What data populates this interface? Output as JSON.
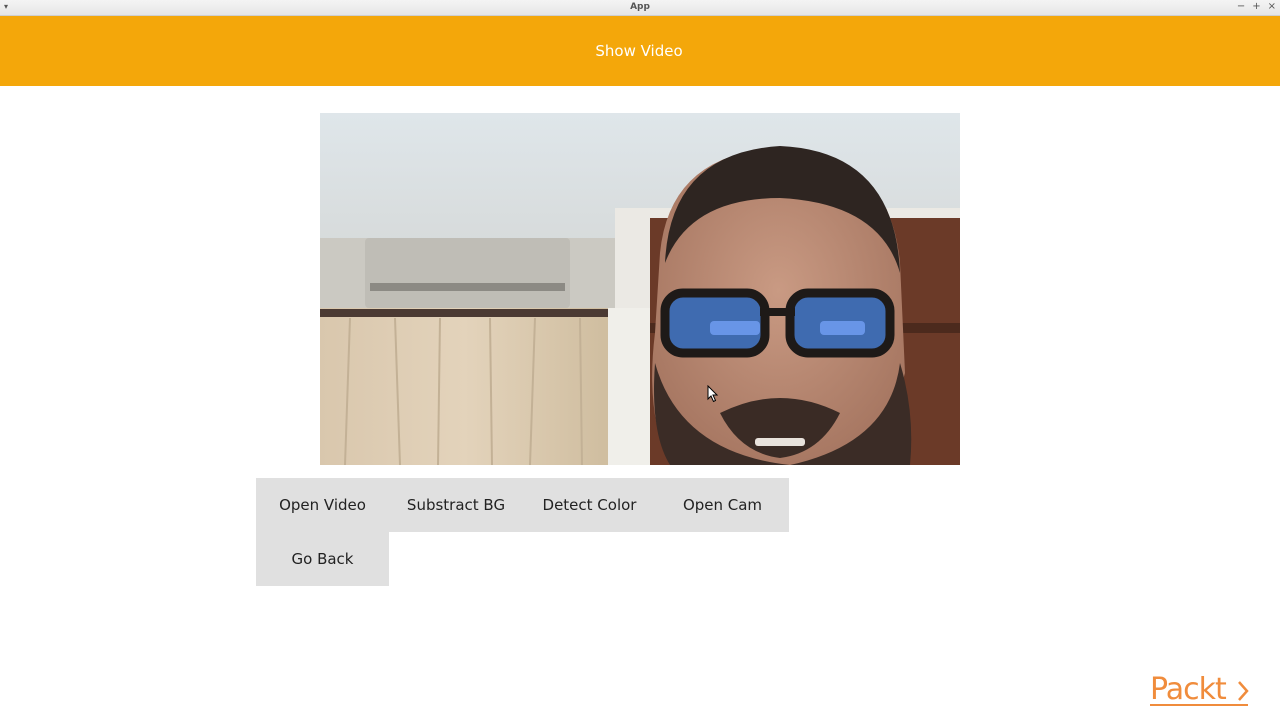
{
  "window": {
    "title": "App",
    "menu_glyph": "▾",
    "minimize_glyph": "−",
    "maximize_glyph": "+",
    "close_glyph": "×"
  },
  "header": {
    "title": "Show Video",
    "color": "#f4a70a"
  },
  "buttons": {
    "open_video": "Open Video",
    "substract_bg": "Substract BG",
    "detect_color": "Detect Color",
    "open_cam": "Open Cam",
    "go_back": "Go Back"
  },
  "logo": {
    "text": "Packt",
    "color": "#f08c3c"
  },
  "icons": [
    "menu-arrow-icon",
    "minimize-icon",
    "maximize-icon",
    "close-icon",
    "mouse-cursor-icon"
  ]
}
